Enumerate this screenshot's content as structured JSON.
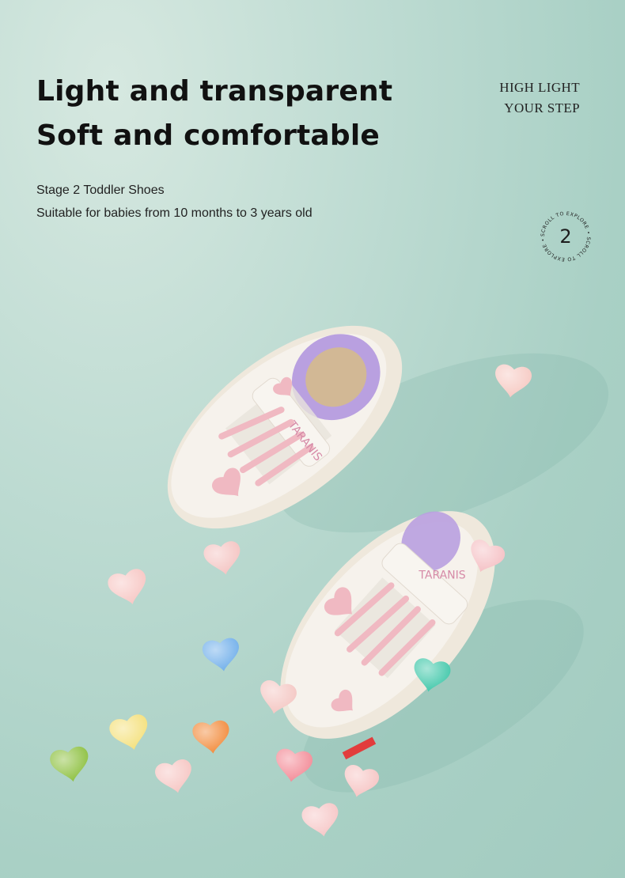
{
  "headline": {
    "line1": "Light and transparent",
    "line2": "Soft and comfortable"
  },
  "subtitle": {
    "line1": "Stage 2 Toddler Shoes",
    "line2": "Suitable for babies from 10 months to 3 years old"
  },
  "tagline": {
    "line1": "HIGH LIGHT",
    "line2": "YOUR STEP"
  },
  "scroll_badge": {
    "ring_text": "SCROLL TO EXPLORE • SCROLL TO EXPLORE •",
    "number": "2"
  },
  "shoe_brand": "TARANIS",
  "colors": {
    "background": "#aed3c8",
    "shoe_white": "#f4f0ea",
    "heart_pink": "#f0b9c2",
    "lining_purple": "#b9a0e0",
    "text": "#111111"
  },
  "hearts": [
    {
      "name": "pink",
      "color": "#f2c1c3"
    },
    {
      "name": "blue",
      "color": "#6faeea"
    },
    {
      "name": "teal",
      "color": "#3fc7a9"
    },
    {
      "name": "yellow",
      "color": "#f4e07a"
    },
    {
      "name": "orange",
      "color": "#f28a3a"
    },
    {
      "name": "green",
      "color": "#8bbf3c"
    },
    {
      "name": "coral",
      "color": "#f38a96"
    }
  ]
}
